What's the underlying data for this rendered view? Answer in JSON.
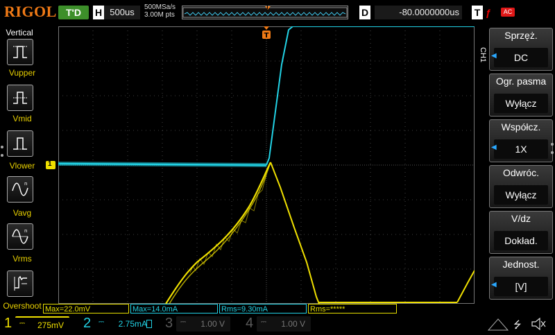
{
  "top": {
    "logo": "RIGOL",
    "status": "T'D",
    "timebase_badge": "H",
    "timebase": "500us",
    "sample_rate": "500MSa/s",
    "memory_depth": "3.00M pts",
    "delay_badge": "D",
    "delay": "-80.0000000us",
    "trigger_badge": "T",
    "trigger_source": "AC",
    "trigger_marker": "T"
  },
  "left_panel": {
    "title": "Vertical",
    "items": [
      {
        "label": "Vupper",
        "icon": "vupper-icon"
      },
      {
        "label": "Vmid",
        "icon": "vmid-icon"
      },
      {
        "label": "Vlower",
        "icon": "vlower-icon"
      },
      {
        "label": "Vavg",
        "icon": "vavg-icon"
      },
      {
        "label": "Vrms",
        "icon": "vrms-icon"
      },
      {
        "label": "Overshoot",
        "icon": "overshoot-icon"
      }
    ]
  },
  "measurements": [
    {
      "text": "Max=22.0mV",
      "color": "#e8e000"
    },
    {
      "text": "Max=14.0mA",
      "color": "#22d3e6"
    },
    {
      "text": "Rms=9.30mA",
      "color": "#22d3e6"
    },
    {
      "text": "Rms=*****",
      "color": "#e8e000"
    }
  ],
  "right_panel": {
    "tab": "CH1",
    "items": [
      {
        "title": "Sprzęż.",
        "value": "DC"
      },
      {
        "title": "Ogr. pasma",
        "value": "Wyłącz"
      },
      {
        "title": "Współcz.",
        "value": "1X"
      },
      {
        "title": "Odwróc.",
        "value": "Wyłącz"
      },
      {
        "title": "V/dz",
        "value": "Dokład."
      },
      {
        "title": "Jednost.",
        "value": "[V]"
      }
    ]
  },
  "channels": [
    {
      "num": "1",
      "scale": "275mV",
      "color": "#f0e000",
      "active": true
    },
    {
      "num": "2",
      "scale": "2.75mA",
      "color": "#22d3e6",
      "active": true
    },
    {
      "num": "3",
      "scale": "1.00 V",
      "color": "#e040c0",
      "active": false
    },
    {
      "num": "4",
      "scale": "1.00 V",
      "color": "#2a6cff",
      "active": false
    }
  ],
  "colors": {
    "ch1": "#f0e000",
    "ch2": "#22d3e6",
    "accent": "#f07a16",
    "grid": "#555555"
  },
  "ch1_marker": "1"
}
